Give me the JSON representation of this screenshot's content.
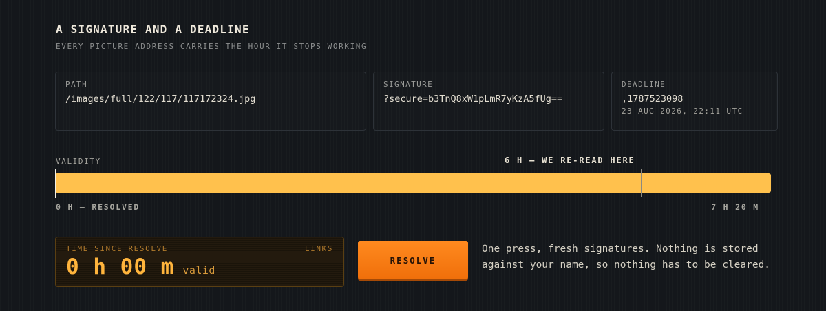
{
  "header": {
    "title": "A SIGNATURE AND A DEADLINE",
    "subtitle": "EVERY PICTURE ADDRESS CARRIES THE HOUR IT STOPS WORKING"
  },
  "cards": {
    "path": {
      "label": "PATH",
      "value": "/images/full/122/117/117172324.jpg"
    },
    "signature": {
      "label": "SIGNATURE",
      "value": "?secure=b3TnQ8xW1pLmR7yKzA5fUg=="
    },
    "deadline": {
      "label": "DEADLINE",
      "value": ",1787523098",
      "sub": "23 AUG 2026, 22:11 UTC"
    }
  },
  "validity": {
    "label": "VALIDITY",
    "marker_label": "6 H — WE RE-READ HERE",
    "start_label": "0 H — RESOLVED",
    "end_label": "7 H 20 M",
    "marker_hours": 6,
    "total_hours": 7.333,
    "elapsed_hours": 0,
    "fill_color": "#ffc14d"
  },
  "counter": {
    "label": "TIME SINCE RESOLVE",
    "links_label": "LINKS",
    "value": "0 h 00 m",
    "status": "valid"
  },
  "resolve_button": {
    "label": "RESOLVE",
    "color": "#ff7d14"
  },
  "note": "One press, fresh signatures. Nothing is stored against your name, so nothing has to be cleared."
}
